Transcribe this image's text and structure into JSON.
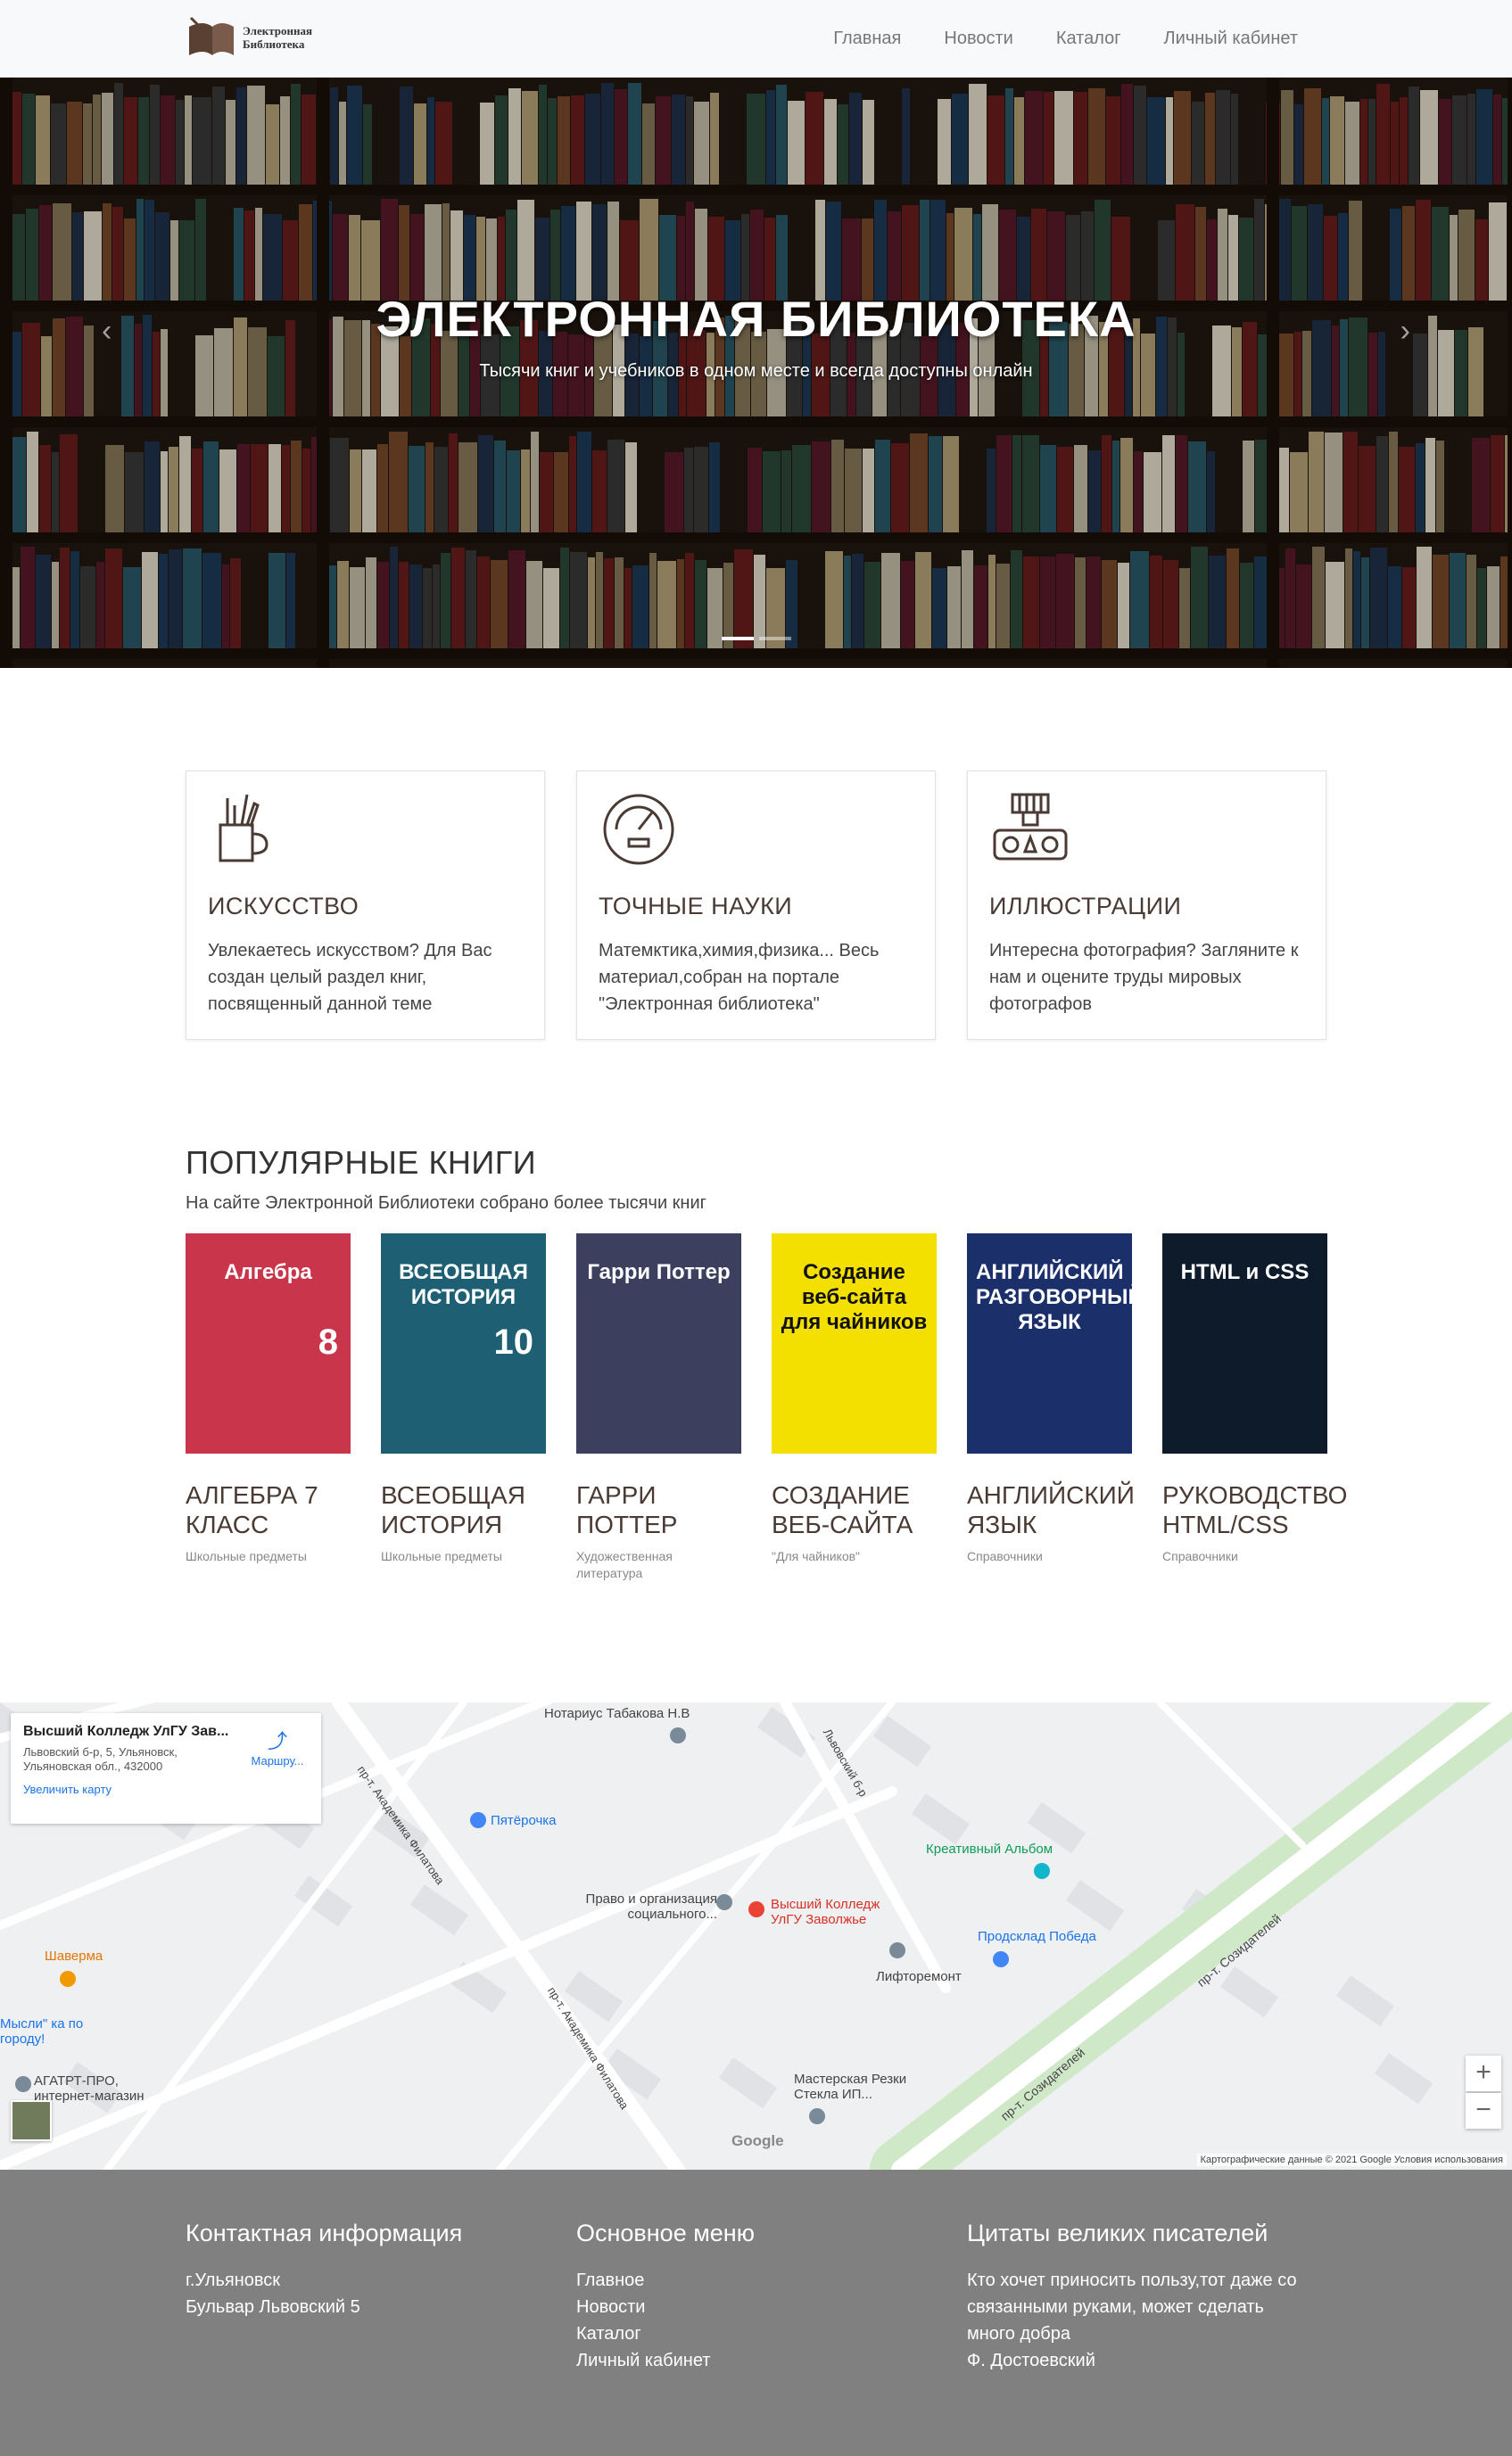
{
  "nav": {
    "logo_line1": "Электронная",
    "logo_line2": "Библиотека",
    "links": [
      "Главная",
      "Новости",
      "Каталог",
      "Личный кабинет"
    ]
  },
  "hero": {
    "title": "ЭЛЕКТРОННАЯ БИБЛИОТЕКА",
    "subtitle": "Тысячи книг и учебников в одном месте и всегда доступны онлайн",
    "slides_total": 2,
    "active_slide": 1
  },
  "features": [
    {
      "title": "ИСКУССТВО",
      "text": "Увлекаетесь искусством? Для Вас создан целый раздел книг, посвященный данной теме",
      "icon": "art-cup-icon"
    },
    {
      "title": "ТОЧНЫЕ НАУКИ",
      "text": "Матемктика,химия,физика... Весь материал,собран на портале \"Электронная библиотека\"",
      "icon": "gauge-icon"
    },
    {
      "title": "ИЛЛЮСТРАЦИИ",
      "text": "Интересна фотография? Загляните к нам и оцените труды мировых фотографов",
      "icon": "camera-icon"
    }
  ],
  "popular": {
    "title": "ПОПУЛЯРНЫЕ КНИГИ",
    "subtitle": "На сайте Электронной Библиотеки собрано более тысячи книг",
    "books": [
      {
        "title": "АЛГЕБРА 7 КЛАСС",
        "category": "Школьные предметы",
        "cover_text": "Алгебра",
        "cover_num": "8",
        "color": "#c9354a"
      },
      {
        "title": "ВСЕОБЩАЯ ИСТОРИЯ",
        "category": "Школьные предметы",
        "cover_text": "ВСЕОБЩАЯ ИСТОРИЯ",
        "cover_num": "10",
        "color": "#1f5f74"
      },
      {
        "title": "ГАРРИ ПОТТЕР",
        "category": "Художественная литература",
        "cover_text": "Гарри Поттер",
        "cover_num": "",
        "color": "#3d3f5e"
      },
      {
        "title": "СОЗДАНИЕ ВЕБ-САЙТА",
        "category": "\"Для чайников\"",
        "cover_text": "Создание веб-сайта для чайников",
        "cover_num": "",
        "color": "#f3e000"
      },
      {
        "title": "АНГЛИЙСКИЙ ЯЗЫК",
        "category": "Справочники",
        "cover_text": "АНГЛИЙСКИЙ РАЗГОВОРНЫЙ ЯЗЫК",
        "cover_num": "",
        "color": "#1b2f6b"
      },
      {
        "title": "РУКОВОДСТВО HTML/CSS",
        "category": "Справочники",
        "cover_text": "HTML и CSS",
        "cover_num": "",
        "color": "#0d1b2a"
      }
    ]
  },
  "map": {
    "place_title": "Высший Колледж УлГУ Зав...",
    "place_address": "Львовский б-р, 5, Ульяновск, Ульяновская обл., 432000",
    "enlarge": "Увеличить карту",
    "route": "Маршру...",
    "attribution": "Картографические данные © 2021 Google   Условия использования",
    "google": "Google",
    "labels": {
      "notary": "Нотариус Табакова Н.В",
      "pyaterochka": "Пятёрочка",
      "creative": "Креативный Альбом",
      "pravo": "Право и организация социального...",
      "college": "Высший Колледж УлГУ Заволжье",
      "lift": "Лифторемонт",
      "prodsklad": "Продсклад Победа",
      "shaverma": "Шаверма",
      "agatrt": "АГАТРТ-ПРО, интернет-магазин",
      "masterskaya": "Мастерская Резки Стекла ИП...",
      "mysli": "Мысли\" ка по городу!",
      "street_sozid": "пр-т. Созидателей",
      "street_akad": "пр-т. Академика Филатова",
      "street_lvov": "Львовский б-р"
    },
    "zoom_in": "+",
    "zoom_out": "−"
  },
  "footer": {
    "contact_title": "Контактная информация",
    "contact_lines": [
      "г.Ульяновск",
      "Бульвар Львовский 5"
    ],
    "menu_title": "Основное меню",
    "menu_lines": [
      "Главное",
      "Новости",
      "Каталог",
      "Личный кабинет"
    ],
    "quote_title": "Цитаты великих писателей",
    "quote_lines": [
      "Кто хочет приносить пользу,тот даже со",
      "связанными руками, может сделать",
      "много добра",
      "Ф. Достоевский"
    ]
  }
}
